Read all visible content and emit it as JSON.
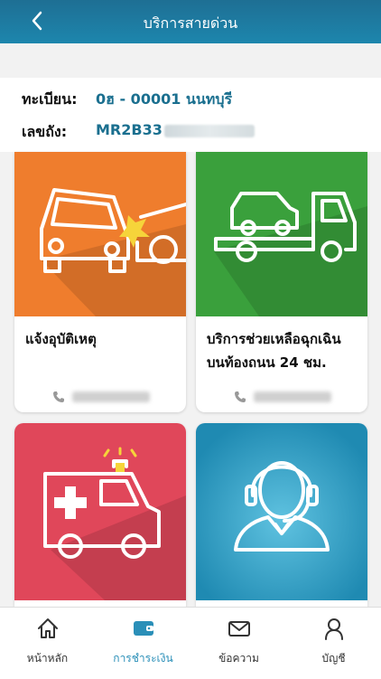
{
  "header": {
    "title": "บริการสายด่วน"
  },
  "vehicle": {
    "plate_label": "ทะเบียน:",
    "plate_value": "0ฮ - 00001 นนทบุรี",
    "chassis_label": "เลขถัง:",
    "chassis_value": "MR2B33"
  },
  "cards": [
    {
      "label": "แจ้งอุบัติเหตุ",
      "phone": "02-429-9000",
      "color": "#ef7d2d"
    },
    {
      "label": "บริการช่วยเหลือฉุกเฉิน บนท้องถนน 24 ชม.",
      "phone": "02-305-4444",
      "color": "#3aa03c"
    },
    {
      "label": "",
      "color": "#e0475a"
    },
    {
      "label": "",
      "color": "#1f8ab2"
    }
  ],
  "nav": {
    "home": "หน้าหลัก",
    "payment": "การชำระเงิน",
    "messages": "ข้อความ",
    "account": "บัญชี"
  },
  "colors": {
    "brand": "#1e7ea6",
    "accent_active": "#2a8fb8",
    "value_text": "#1a6f8f"
  }
}
